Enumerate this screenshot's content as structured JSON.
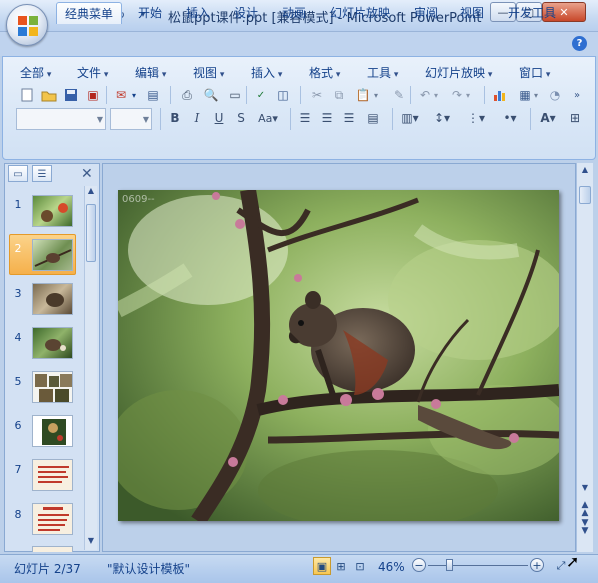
{
  "window": {
    "title": "松鼠ppt课件.ppt [兼容模式] - Microsoft PowerPoint"
  },
  "ribbon": {
    "tabs": [
      {
        "label": "经典菜单",
        "active": true
      },
      {
        "label": "开始"
      },
      {
        "label": "插入"
      },
      {
        "label": "设计"
      },
      {
        "label": "动画"
      },
      {
        "label": "幻灯片放映"
      },
      {
        "label": "审阅"
      },
      {
        "label": "视图"
      },
      {
        "label": "开发工具"
      }
    ],
    "menus": [
      "全部",
      "文件",
      "编辑",
      "视图",
      "插入",
      "格式",
      "工具",
      "幻灯片放映",
      "窗口"
    ],
    "watermark": "0609--"
  },
  "slides_pane": {
    "numbers": [
      "1",
      "2",
      "3",
      "4",
      "5",
      "6",
      "7",
      "8"
    ],
    "selected": "2"
  },
  "status": {
    "slide_indicator": "幻灯片 2/37",
    "theme": "\"默认设计模板\"",
    "zoom": "46%",
    "zoom_fraction": 0.46
  },
  "colors": {
    "accent": "#15428b",
    "ribbon_bg": "#dbe8f7",
    "selection": "#f5b04b"
  }
}
